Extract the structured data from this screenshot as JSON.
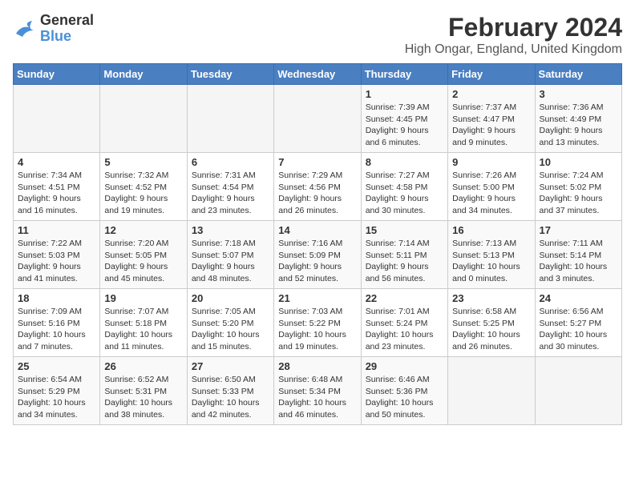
{
  "logo": {
    "text_general": "General",
    "text_blue": "Blue"
  },
  "header": {
    "month": "February 2024",
    "location": "High Ongar, England, United Kingdom"
  },
  "weekdays": [
    "Sunday",
    "Monday",
    "Tuesday",
    "Wednesday",
    "Thursday",
    "Friday",
    "Saturday"
  ],
  "weeks": [
    [
      {
        "day": "",
        "info": ""
      },
      {
        "day": "",
        "info": ""
      },
      {
        "day": "",
        "info": ""
      },
      {
        "day": "",
        "info": ""
      },
      {
        "day": "1",
        "info": "Sunrise: 7:39 AM\nSunset: 4:45 PM\nDaylight: 9 hours\nand 6 minutes."
      },
      {
        "day": "2",
        "info": "Sunrise: 7:37 AM\nSunset: 4:47 PM\nDaylight: 9 hours\nand 9 minutes."
      },
      {
        "day": "3",
        "info": "Sunrise: 7:36 AM\nSunset: 4:49 PM\nDaylight: 9 hours\nand 13 minutes."
      }
    ],
    [
      {
        "day": "4",
        "info": "Sunrise: 7:34 AM\nSunset: 4:51 PM\nDaylight: 9 hours\nand 16 minutes."
      },
      {
        "day": "5",
        "info": "Sunrise: 7:32 AM\nSunset: 4:52 PM\nDaylight: 9 hours\nand 19 minutes."
      },
      {
        "day": "6",
        "info": "Sunrise: 7:31 AM\nSunset: 4:54 PM\nDaylight: 9 hours\nand 23 minutes."
      },
      {
        "day": "7",
        "info": "Sunrise: 7:29 AM\nSunset: 4:56 PM\nDaylight: 9 hours\nand 26 minutes."
      },
      {
        "day": "8",
        "info": "Sunrise: 7:27 AM\nSunset: 4:58 PM\nDaylight: 9 hours\nand 30 minutes."
      },
      {
        "day": "9",
        "info": "Sunrise: 7:26 AM\nSunset: 5:00 PM\nDaylight: 9 hours\nand 34 minutes."
      },
      {
        "day": "10",
        "info": "Sunrise: 7:24 AM\nSunset: 5:02 PM\nDaylight: 9 hours\nand 37 minutes."
      }
    ],
    [
      {
        "day": "11",
        "info": "Sunrise: 7:22 AM\nSunset: 5:03 PM\nDaylight: 9 hours\nand 41 minutes."
      },
      {
        "day": "12",
        "info": "Sunrise: 7:20 AM\nSunset: 5:05 PM\nDaylight: 9 hours\nand 45 minutes."
      },
      {
        "day": "13",
        "info": "Sunrise: 7:18 AM\nSunset: 5:07 PM\nDaylight: 9 hours\nand 48 minutes."
      },
      {
        "day": "14",
        "info": "Sunrise: 7:16 AM\nSunset: 5:09 PM\nDaylight: 9 hours\nand 52 minutes."
      },
      {
        "day": "15",
        "info": "Sunrise: 7:14 AM\nSunset: 5:11 PM\nDaylight: 9 hours\nand 56 minutes."
      },
      {
        "day": "16",
        "info": "Sunrise: 7:13 AM\nSunset: 5:13 PM\nDaylight: 10 hours\nand 0 minutes."
      },
      {
        "day": "17",
        "info": "Sunrise: 7:11 AM\nSunset: 5:14 PM\nDaylight: 10 hours\nand 3 minutes."
      }
    ],
    [
      {
        "day": "18",
        "info": "Sunrise: 7:09 AM\nSunset: 5:16 PM\nDaylight: 10 hours\nand 7 minutes."
      },
      {
        "day": "19",
        "info": "Sunrise: 7:07 AM\nSunset: 5:18 PM\nDaylight: 10 hours\nand 11 minutes."
      },
      {
        "day": "20",
        "info": "Sunrise: 7:05 AM\nSunset: 5:20 PM\nDaylight: 10 hours\nand 15 minutes."
      },
      {
        "day": "21",
        "info": "Sunrise: 7:03 AM\nSunset: 5:22 PM\nDaylight: 10 hours\nand 19 minutes."
      },
      {
        "day": "22",
        "info": "Sunrise: 7:01 AM\nSunset: 5:24 PM\nDaylight: 10 hours\nand 23 minutes."
      },
      {
        "day": "23",
        "info": "Sunrise: 6:58 AM\nSunset: 5:25 PM\nDaylight: 10 hours\nand 26 minutes."
      },
      {
        "day": "24",
        "info": "Sunrise: 6:56 AM\nSunset: 5:27 PM\nDaylight: 10 hours\nand 30 minutes."
      }
    ],
    [
      {
        "day": "25",
        "info": "Sunrise: 6:54 AM\nSunset: 5:29 PM\nDaylight: 10 hours\nand 34 minutes."
      },
      {
        "day": "26",
        "info": "Sunrise: 6:52 AM\nSunset: 5:31 PM\nDaylight: 10 hours\nand 38 minutes."
      },
      {
        "day": "27",
        "info": "Sunrise: 6:50 AM\nSunset: 5:33 PM\nDaylight: 10 hours\nand 42 minutes."
      },
      {
        "day": "28",
        "info": "Sunrise: 6:48 AM\nSunset: 5:34 PM\nDaylight: 10 hours\nand 46 minutes."
      },
      {
        "day": "29",
        "info": "Sunrise: 6:46 AM\nSunset: 5:36 PM\nDaylight: 10 hours\nand 50 minutes."
      },
      {
        "day": "",
        "info": ""
      },
      {
        "day": "",
        "info": ""
      }
    ]
  ]
}
